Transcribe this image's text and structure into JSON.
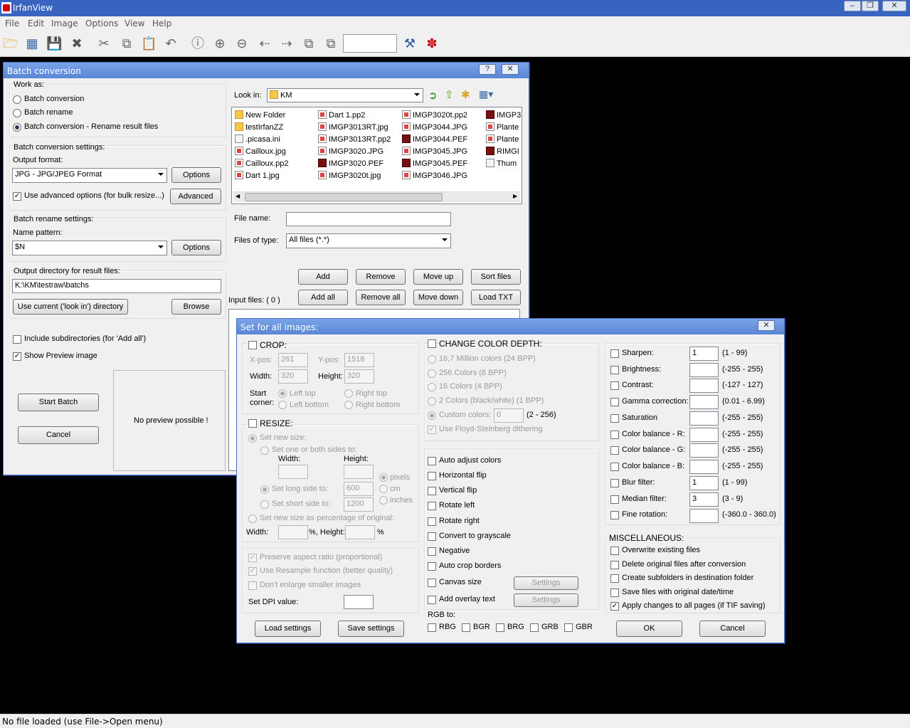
{
  "app": {
    "title": "IrfanView",
    "menu": [
      "File",
      "Edit",
      "Image",
      "Options",
      "View",
      "Help"
    ],
    "status": "No file loaded (use File->Open menu)"
  },
  "toolbar_icons": [
    "open-folder-icon",
    "thumbnails-icon",
    "save-icon",
    "delete-icon",
    "cut-icon",
    "copy-icon",
    "paste-icon",
    "undo-icon",
    "info-icon",
    "zoom-in-icon",
    "zoom-out-icon",
    "previous-icon",
    "next-icon",
    "page-up-icon",
    "page-down-icon",
    "wrench-icon",
    "irfan-logo-icon"
  ],
  "batch": {
    "title": "Batch conversion",
    "work_as_label": "Work as:",
    "modes": [
      "Batch conversion",
      "Batch rename",
      "Batch conversion - Rename result files"
    ],
    "conv_settings_label": "Batch conversion settings:",
    "output_format_label": "Output format:",
    "output_format": "JPG - JPG/JPEG Format",
    "options": "Options",
    "adv_check": "Use advanced options (for bulk resize...)",
    "advanced": "Advanced",
    "rename_settings_label": "Batch rename settings:",
    "name_pattern_label": "Name pattern:",
    "name_pattern": "$N",
    "outdir_label": "Output directory for result files:",
    "outdir": "K:\\KM\\testraw\\batchs",
    "use_current": "Use current ('look in') directory",
    "browse": "Browse",
    "include_sub": "Include subdirectories (for 'Add all')",
    "show_preview": "Show Preview image",
    "start": "Start Batch",
    "cancel": "Cancel",
    "no_preview": "No preview possible !",
    "look_in_label": "Look in:",
    "look_in": "KM",
    "files": [
      [
        "New Folder",
        "testIrfanZZ",
        ".picasa.ini",
        "Cailloux.jpg",
        "Cailloux.pp2",
        "Dart 1.jpg"
      ],
      [
        "Dart 1.pp2",
        "IMGP3013RT.jpg",
        "IMGP3013RT.pp2",
        "IMGP3020.JPG",
        "IMGP3020.PEF",
        "IMGP3020t.jpg"
      ],
      [
        "IMGP3020t.pp2",
        "IMGP3044.JPG",
        "IMGP3044.PEF",
        "IMGP3045.JPG",
        "IMGP3045.PEF",
        "IMGP3046.JPG"
      ],
      [
        "IMGP3",
        "Plante",
        "Plante",
        "RIMGI",
        "Thum"
      ]
    ],
    "file_name_label": "File name:",
    "file_name": "",
    "files_type_label": "Files of type:",
    "files_type": "All files (*.*)",
    "add": "Add",
    "remove": "Remove",
    "move_up": "Move up",
    "sort_files": "Sort files",
    "add_all": "Add all",
    "remove_all": "Remove all",
    "move_down": "Move down",
    "load_txt": "Load TXT",
    "input_files": "Input files: ( 0 )"
  },
  "setall": {
    "title": "Set for all images:",
    "crop": "CROP:",
    "xpos_label": "X-pos:",
    "xpos": "261",
    "ypos_label": "Y-pos:",
    "ypos": "1518",
    "width_label": "Width:",
    "width": "320",
    "height_label": "Height:",
    "height": "320",
    "start_corner": [
      "Start",
      "corner:"
    ],
    "corners": [
      "Left top",
      "Right top",
      "Left bottom",
      "Right bottom"
    ],
    "resize": "RESIZE:",
    "set_new_size": "Set new size:",
    "one_or_both": "Set one or both sides to:",
    "r_width": "Width:",
    "r_height": "Height:",
    "units": [
      "pixels",
      "cm",
      "inches"
    ],
    "long_side": "Set long side to:",
    "long_val": "600",
    "short_side": "Set short side to:",
    "short_val": "1200",
    "pct": "Set new size as percentage of original:",
    "pct_width": "Width:",
    "pct_pct": "%, Height:",
    "pct_sign": "%",
    "preserve": "Preserve aspect ratio (proportional)",
    "resample": "Use Resample function (better quality)",
    "dont_enlarge": "Don't enlarge smaller images",
    "dpi": "Set DPI value:",
    "load_settings": "Load settings",
    "save_settings": "Save settings",
    "color_depth": "CHANGE COLOR DEPTH:",
    "depths": [
      "16,7 Million colors (24 BPP)",
      "256 Colors (8 BPP)",
      "16 Colors (4 BPP)",
      "2 Colors (black/white) (1 BPP)",
      "Custom colors:"
    ],
    "custom_val": "0",
    "custom_range": "(2 - 256)",
    "dither": "Use Floyd-Steinberg dithering",
    "ops": [
      "Auto adjust colors",
      "Horizontal flip",
      "Vertical flip",
      "Rotate left",
      "Rotate right",
      "Convert to grayscale",
      "Negative",
      "Auto crop borders",
      "Canvas size",
      "Add overlay text"
    ],
    "settings": "Settings",
    "rgb_to": "RGB to:",
    "rgb": [
      "RBG",
      "BGR",
      "BRG",
      "GRB",
      "GBR"
    ],
    "adj": [
      {
        "label": "Sharpen:",
        "val": "1",
        "range": "(1  -  99)"
      },
      {
        "label": "Brightness:",
        "val": "",
        "range": "(-255  -  255)"
      },
      {
        "label": "Contrast:",
        "val": "",
        "range": "(-127  -  127)"
      },
      {
        "label": "Gamma correction:",
        "val": "",
        "range": "(0.01  -  6.99)"
      },
      {
        "label": "Saturation",
        "val": "",
        "range": "(-255  -  255)"
      },
      {
        "label": "Color balance - R:",
        "val": "",
        "range": "(-255  -  255)"
      },
      {
        "label": "Color balance - G:",
        "val": "",
        "range": "(-255  -  255)"
      },
      {
        "label": "Color balance - B:",
        "val": "",
        "range": "(-255  -  255)"
      },
      {
        "label": "Blur filter:",
        "val": "1",
        "range": "(1  -  99)"
      },
      {
        "label": "Median filter:",
        "val": "3",
        "range": "(3  -  9)"
      },
      {
        "label": "Fine rotation:",
        "val": "",
        "range": "(-360.0  -  360.0)"
      }
    ],
    "misc": "MISCELLANEOUS:",
    "misc_items": [
      "Overwrite existing files",
      "Delete original files after conversion",
      "Create subfolders in destination folder",
      "Save files with original date/time",
      "Apply changes to all pages (if TIF saving)"
    ],
    "ok": "OK",
    "cancel": "Cancel"
  }
}
